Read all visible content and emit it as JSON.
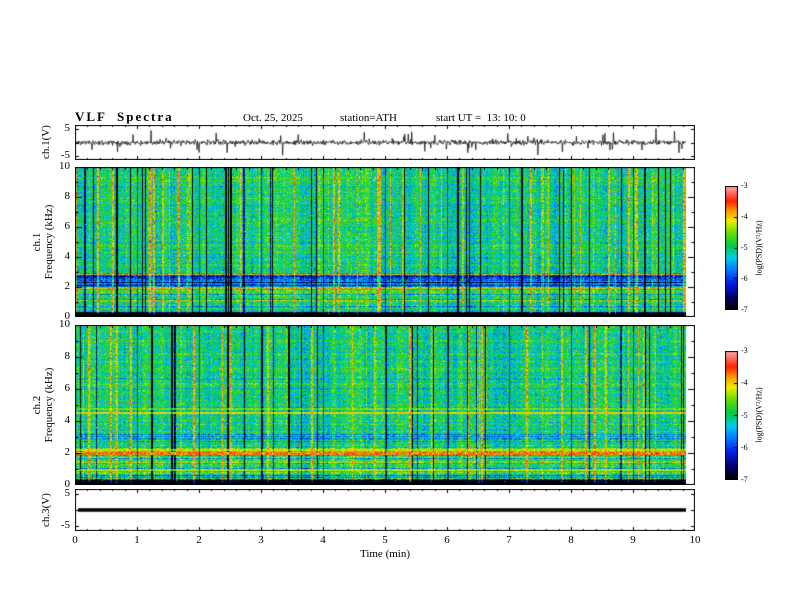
{
  "header": {
    "title": "VLF  Spectra",
    "date": "Oct. 25, 2025",
    "station": "station=ATH",
    "start_ut": "start UT =  13: 10: 0"
  },
  "xaxis": {
    "label": "Time (min)",
    "min": 0,
    "max": 10,
    "major_ticks": [
      0,
      1,
      2,
      3,
      4,
      5,
      6,
      7,
      8,
      9,
      10
    ],
    "minor_per_major": 5,
    "data_end": 9.85
  },
  "colorbar": {
    "label": "log(PSD)(V²/Hz)",
    "min": -7,
    "max": -3,
    "ticks": [
      -3,
      -4,
      -5,
      -6,
      -7
    ],
    "colormap": [
      {
        "t": 0.0,
        "color": "#000000"
      },
      {
        "t": 0.1,
        "color": "#000066"
      },
      {
        "t": 0.22,
        "color": "#0022ee"
      },
      {
        "t": 0.32,
        "color": "#0077ff"
      },
      {
        "t": 0.42,
        "color": "#00ccee"
      },
      {
        "t": 0.52,
        "color": "#00cc44"
      },
      {
        "t": 0.62,
        "color": "#66dd00"
      },
      {
        "t": 0.72,
        "color": "#eeee00"
      },
      {
        "t": 0.8,
        "color": "#ff9900"
      },
      {
        "t": 0.88,
        "color": "#ff2200"
      },
      {
        "t": 1.0,
        "color": "#ffaaaa"
      }
    ]
  },
  "chart_data": [
    {
      "id": "ch1-waveform",
      "type": "line",
      "ylabel": "ch.1(V)",
      "ylim": [
        -5,
        5
      ],
      "yticks": [
        5,
        -5
      ],
      "x_range": [
        0,
        9.85
      ],
      "summary": "broadband noise around 0 V with dense impulsive spikes reaching about ±4 to ±5 V over the full 0–9.85 min record",
      "seed": 11,
      "spike_prob": 0.04,
      "spike_amp": 3.2
    },
    {
      "id": "ch1-spectrogram",
      "type": "heatmap",
      "ylabel_line1": "ch.1",
      "ylabel_line2": "Frequency (kHz)",
      "ylim": [
        0,
        10
      ],
      "yticks": [
        0,
        2,
        4,
        6,
        8,
        10
      ],
      "zlabel": "log(PSD)(V²/Hz)",
      "zlim": [
        -7,
        -3
      ],
      "summary": "mostly green/yellow broadband noise near -5 to -4.5 log PSD above 3 kHz, sporadic red bursts near -3.5, dark blue vertical dropout columns near -6.5, and blue/black horizontal banding below 3 kHz including a blue band at 2-2.8 kHz and a near-black band below 0.35 kHz",
      "seed": 23,
      "base": -5.0,
      "bands": [
        {
          "f0": 2.0,
          "f1": 2.8,
          "dv": -0.9
        },
        {
          "f0": 0.0,
          "f1": 0.35,
          "dv": -1.2
        }
      ],
      "hlines": []
    },
    {
      "id": "ch2-spectrogram",
      "type": "heatmap",
      "ylabel_line1": "ch.2",
      "ylabel_line2": "Frequency (kHz)",
      "ylim": [
        0,
        10
      ],
      "yticks": [
        0,
        2,
        4,
        6,
        8,
        10
      ],
      "zlabel": "log(PSD)(V²/Hz)",
      "zlim": [
        -7,
        -3
      ],
      "summary": "similar green broadband noise with vertical dropouts, plus persistent orange/red horizontal interference lines near 1, 2, 2.2, 4.5 and 4.75 kHz and dark banding below 0.35 kHz",
      "seed": 57,
      "base": -5.0,
      "bands": [
        {
          "f0": 0.0,
          "f1": 0.35,
          "dv": -1.2
        }
      ],
      "hlines": [
        {
          "f": 1.95,
          "w": 0.09,
          "v": -3.7
        },
        {
          "f": 2.2,
          "w": 0.06,
          "v": -4.2
        },
        {
          "f": 4.5,
          "w": 0.09,
          "v": -4.1
        },
        {
          "f": 4.75,
          "w": 0.05,
          "v": -4.5
        },
        {
          "f": 0.95,
          "w": 0.05,
          "v": -4.3
        }
      ]
    },
    {
      "id": "ch3-waveform",
      "type": "line",
      "ylabel": "ch.3(V)",
      "ylim": [
        -5,
        5
      ],
      "yticks": [
        5,
        -5
      ],
      "x_range": [
        0,
        9.85
      ],
      "constant": 0,
      "summary": "flat thick black line at 0 V for the whole record (inactive channel)",
      "seed": 99
    }
  ]
}
